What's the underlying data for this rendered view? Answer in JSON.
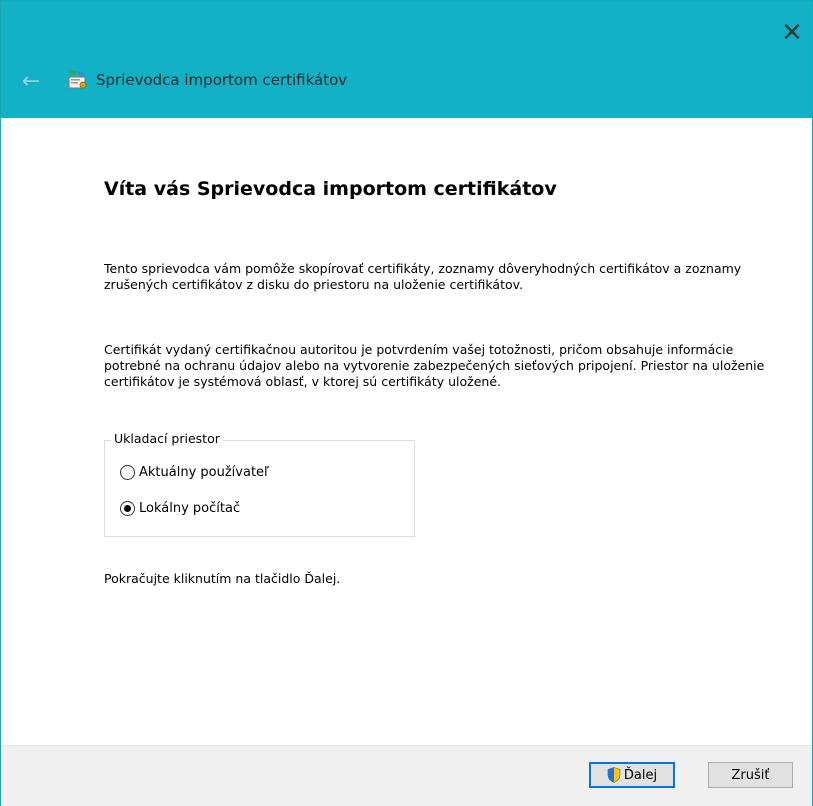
{
  "window": {
    "title": "Sprievodca importom certifikátov",
    "close_glyph": "✕",
    "back_glyph": "←",
    "icon": "certificate-wizard-icon"
  },
  "page": {
    "heading": "Víta vás Sprievodca importom certifikátov",
    "paragraph1": "Tento sprievodca vám pomôže skopírovať certifikáty, zoznamy dôveryhodných certifikátov a zoznamy zrušených certifikátov z disku do priestoru na uloženie certifikátov.",
    "paragraph2": "Certifikát vydaný certifikačnou autoritou je potvrdením vašej totožnosti, pričom obsahuje informácie potrebné na ochranu údajov alebo na vytvorenie zabezpečených sieťových pripojení. Priestor na uloženie certifikátov je systémová oblasť, v ktorej sú certifikáty uložené.",
    "store_group": {
      "legend": "Ukladací priestor",
      "options": [
        {
          "label": "Aktuálny používateľ",
          "checked": false
        },
        {
          "label": "Lokálny počítač",
          "checked": true
        }
      ]
    },
    "hint": "Pokračujte kliknutím na tlačidlo Ďalej."
  },
  "footer": {
    "next_label": "Ďalej",
    "cancel_label": "Zrušiť"
  },
  "colors": {
    "titlebar": "#13b1c6",
    "footer": "#f0f0f0",
    "focus_border": "#0078d7"
  }
}
